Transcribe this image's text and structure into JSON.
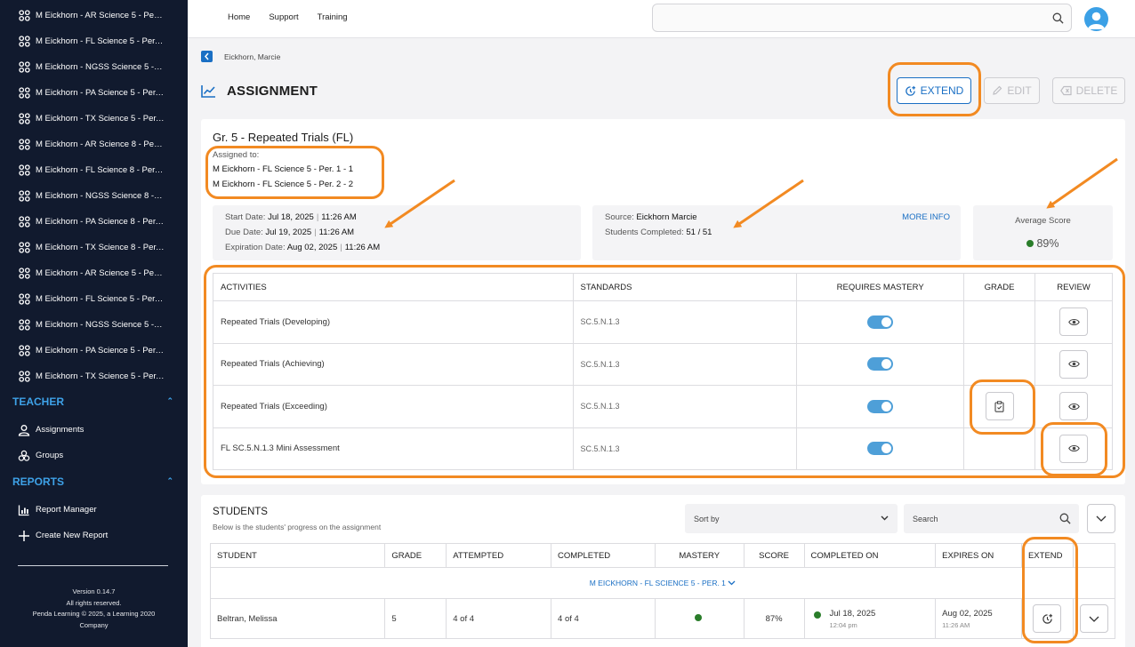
{
  "sidebar": {
    "classes": [
      "M Eickhorn - AR Science 5 - Per. ...",
      "M Eickhorn - FL Science 5 - Per. 1...",
      "M Eickhorn - NGSS Science 5 - Pe...",
      "M Eickhorn - PA Science 5 - Per. 1...",
      "M Eickhorn - TX Science 5 - Per. 1...",
      "M Eickhorn - AR Science 8 - Per. ...",
      "M Eickhorn - FL Science 8 - Per. 2...",
      "M Eickhorn - NGSS Science 8 - Pe...",
      "M Eickhorn - PA Science 8 - Per. 2...",
      "M Eickhorn - TX Science 8 - Per. 2...",
      "M Eickhorn - AR Science 5 - Per. ...",
      "M Eickhorn - FL Science 5 - Per. 2...",
      "M Eickhorn - NGSS Science 5 - Pe...",
      "M Eickhorn - PA Science 5 - Per. 2...",
      "M Eickhorn - TX Science 5 - Per. 2..."
    ],
    "teacher_label": "TEACHER",
    "assignments_label": "Assignments",
    "groups_label": "Groups",
    "reports_label": "REPORTS",
    "report_manager_label": "Report Manager",
    "create_report_label": "Create New Report",
    "version": "Version 0.14.7",
    "rights": "All rights reserved.",
    "copyright": "Penda Learning © 2025, a Learning 2020",
    "company": "Company"
  },
  "nav": {
    "home": "Home",
    "support": "Support",
    "training": "Training"
  },
  "breadcrumb": "Eickhorn, Marcie",
  "page_title": "ASSIGNMENT",
  "actions": {
    "extend": "EXTEND",
    "edit": "EDIT",
    "delete": "DELETE"
  },
  "assignment": {
    "name": "Gr. 5 - Repeated Trials (FL)",
    "assigned_to_label": "Assigned to:",
    "assigned_to": [
      "M Eickhorn - FL Science 5 - Per. 1 - 1",
      "M Eickhorn - FL Science 5 - Per. 2 - 2"
    ],
    "start_label": "Start Date:",
    "start_date": "Jul 18, 2025",
    "start_time": "11:26 AM",
    "due_label": "Due Date:",
    "due_date": "Jul 19, 2025",
    "due_time": "11:26 AM",
    "exp_label": "Expiration Date:",
    "exp_date": "Aug 02, 2025",
    "exp_time": "11:26 AM",
    "source_label": "Source:",
    "source": "Eickhorn Marcie",
    "completed_label": "Students Completed:",
    "completed": "51 / 51",
    "more_info": "MORE INFO",
    "avg_label": "Average Score",
    "avg_score": "89%"
  },
  "activities": {
    "headers": {
      "activity": "ACTIVITIES",
      "standards": "STANDARDS",
      "mastery": "REQUIRES MASTERY",
      "grade": "GRADE",
      "review": "REVIEW"
    },
    "rows": [
      {
        "name": "Repeated Trials (Developing)",
        "standard": "SC.5.N.1.3"
      },
      {
        "name": "Repeated Trials (Achieving)",
        "standard": "SC.5.N.1.3"
      },
      {
        "name": "Repeated Trials (Exceeding)",
        "standard": "SC.5.N.1.3"
      },
      {
        "name": "FL SC.5.N.1.3 Mini Assessment",
        "standard": "SC.5.N.1.3"
      }
    ]
  },
  "students": {
    "title": "STUDENTS",
    "subtitle": "Below is the students' progress on the assignment",
    "sort_placeholder": "Sort by",
    "search_placeholder": "Search",
    "headers": {
      "student": "STUDENT",
      "grade": "GRADE",
      "attempted": "ATTEMPTED",
      "completed": "COMPLETED",
      "mastery": "MASTERY",
      "score": "SCORE",
      "completed_on": "COMPLETED ON",
      "expires_on": "EXPIRES ON",
      "extend": "EXTEND"
    },
    "group": "M EICKHORN - FL SCIENCE 5 - PER. 1",
    "rows": [
      {
        "name": "Beltran, Melissa",
        "grade": "5",
        "attempted": "4 of 4",
        "completed": "4 of 4",
        "score": "87%",
        "completed_on": "Jul 18, 2025",
        "completed_time": "12:04 pm",
        "expires_on": "Aug 02, 2025",
        "expires_time": "11:26 AM"
      }
    ]
  },
  "colors": {
    "sidebar": "#111a2e",
    "accent": "#1a6fc4",
    "highlight": "#f28a22",
    "mastery_dot": "#2a7d2a"
  }
}
